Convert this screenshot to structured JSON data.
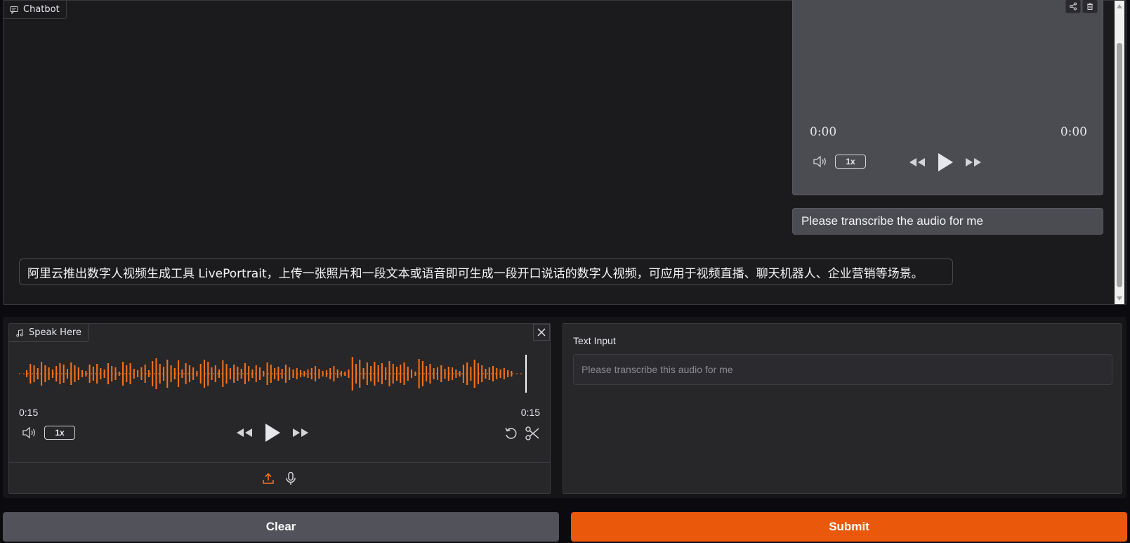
{
  "chatbot": {
    "label": "Chatbot",
    "user_audio": {
      "time_current": "0:00",
      "time_total": "0:00",
      "speed": "1x"
    },
    "user_message": "Please transcribe the audio for me",
    "bot_message": "阿里云推出数字人视频生成工具 LivePortrait，上传一张照片和一段文本或语音即可生成一段开口说话的数字人视频，可应用于视频直播、聊天机器人、企业营销等场景。"
  },
  "audio_input": {
    "label": "Speak Here",
    "time_current": "0:15",
    "time_total": "0:15",
    "speed": "1x",
    "waveform_color": "#f97316"
  },
  "text_input": {
    "label": "Text Input",
    "placeholder": "Please transcribe this audio for me",
    "value": ""
  },
  "buttons": {
    "clear": "Clear",
    "submit": "Submit"
  },
  "colors": {
    "accent": "#ea580c",
    "secondary_button": "#52525b"
  }
}
